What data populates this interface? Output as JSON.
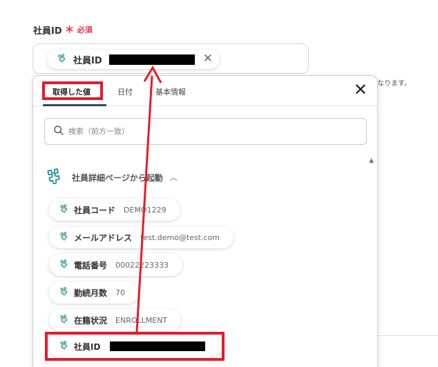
{
  "field": {
    "label": "社員ID",
    "required_star": "＊",
    "required_text": "必須",
    "chip_label": "社員ID",
    "clear_icon": "close-icon"
  },
  "background_text": "なります。",
  "panel": {
    "tabs": [
      {
        "label": "取得した値",
        "active": true
      },
      {
        "label": "日付",
        "active": false
      },
      {
        "label": "基本情報",
        "active": false
      }
    ],
    "close_icon": "close-icon",
    "search": {
      "placeholder": "検索（前方一致）"
    },
    "group": {
      "label": "社員詳細ページから起動",
      "icon": "puzzle-icon"
    },
    "items": [
      {
        "label": "社員コード",
        "value": "DEMO1229"
      },
      {
        "label": "メールアドレス",
        "value": "test.demo@test.com"
      },
      {
        "label": "電話番号",
        "value": "00022223333"
      },
      {
        "label": "勤続月数",
        "value": "70"
      },
      {
        "label": "在籍状況",
        "value": "ENROLLMENT"
      },
      {
        "label": "社員ID",
        "value": ""
      }
    ]
  },
  "colors": {
    "required": "#e8334a",
    "highlight": "#e8192c",
    "icon_teal": "#1a8a94",
    "tab_underline": "#2f4858"
  }
}
